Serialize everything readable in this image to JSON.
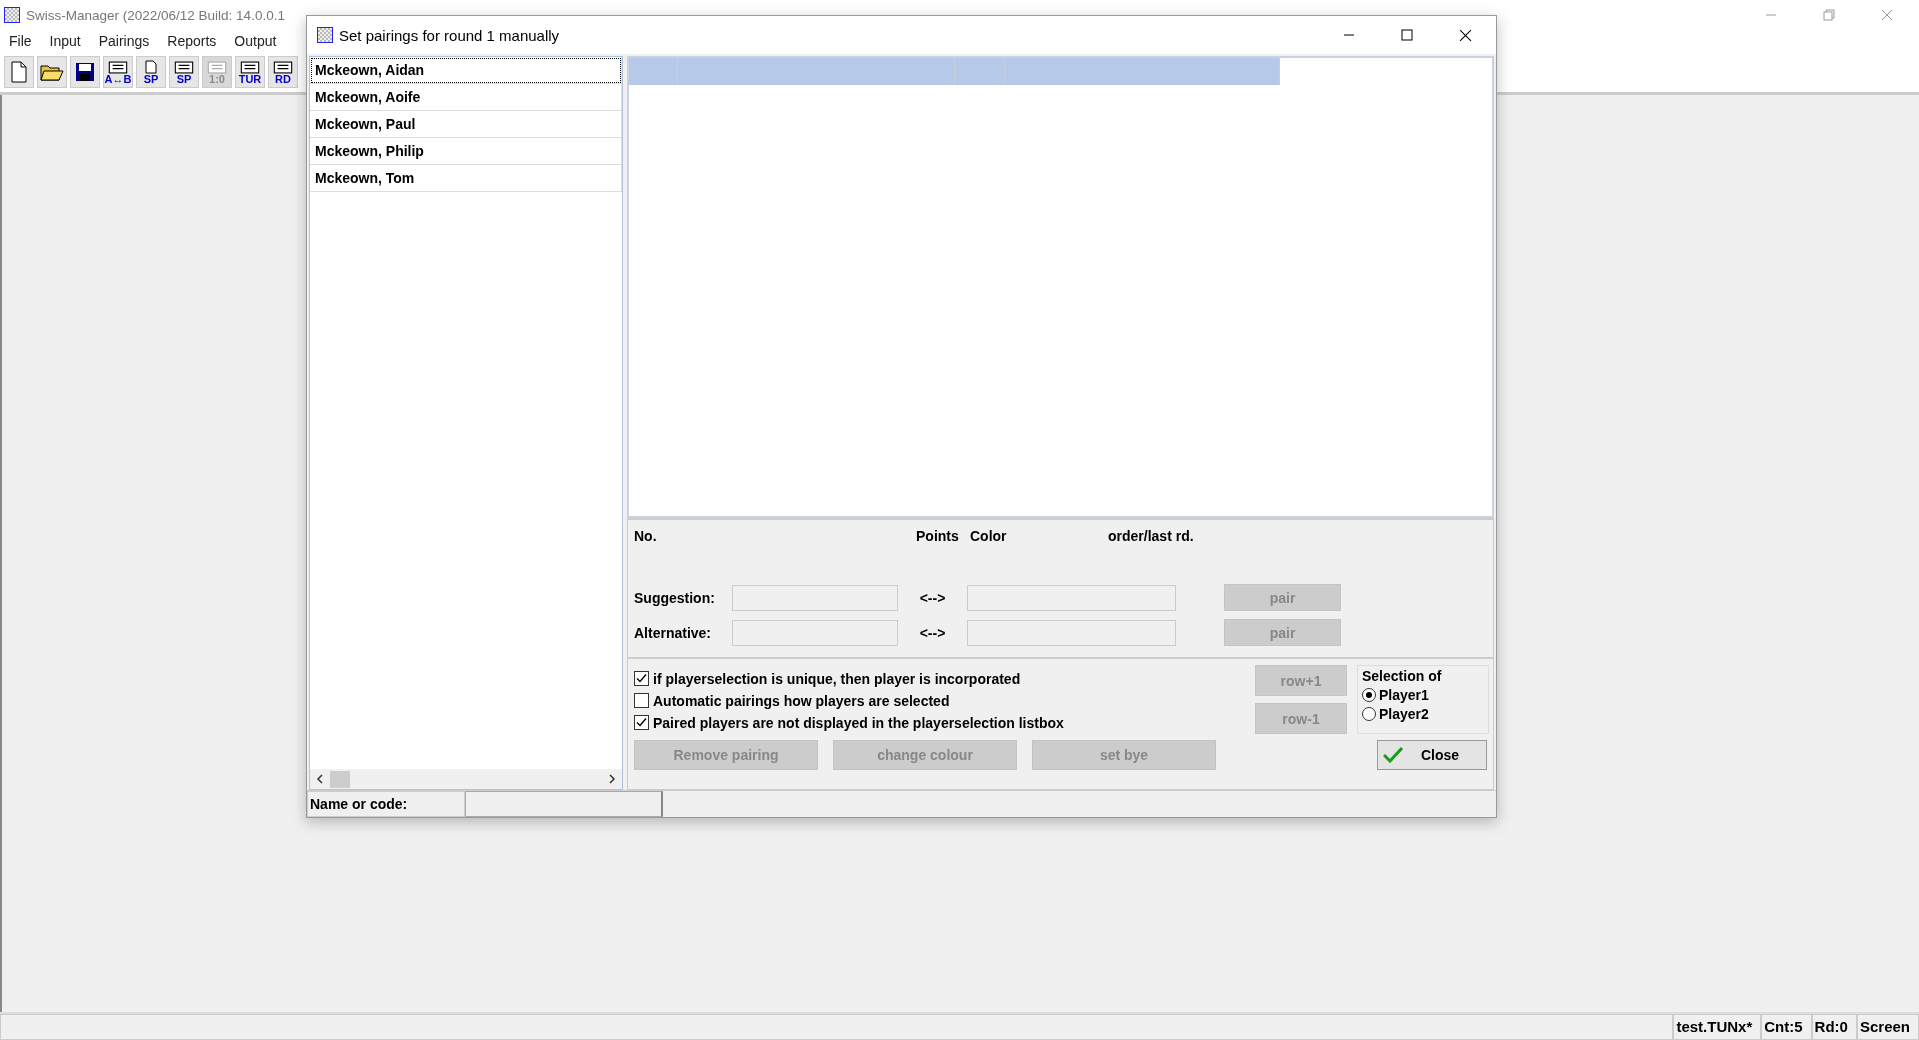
{
  "app": {
    "title": "Swiss-Manager (2022/06/12 Build: 14.0.0.1",
    "menu": [
      "File",
      "Input",
      "Pairings",
      "Reports",
      "Output"
    ],
    "toolbar": [
      {
        "kind": "new"
      },
      {
        "kind": "open"
      },
      {
        "kind": "save"
      },
      {
        "kind": "sheet",
        "label": "A↔B",
        "disabled": false
      },
      {
        "kind": "page",
        "label": "SP",
        "disabled": false
      },
      {
        "kind": "sheet",
        "label": "SP",
        "disabled": false
      },
      {
        "kind": "sheet",
        "label": "1:0",
        "disabled": true
      },
      {
        "kind": "sheet",
        "label": "TUR",
        "disabled": false
      },
      {
        "kind": "sheet",
        "label": "RD",
        "disabled": false
      }
    ]
  },
  "dialog": {
    "title": "Set pairings for round 1 manually",
    "players": [
      {
        "name": "Mckeown, Aidan",
        "selected": true
      },
      {
        "name": "Mckeown, Aoife",
        "selected": false
      },
      {
        "name": "Mckeown, Paul",
        "selected": false
      },
      {
        "name": "Mckeown, Philip",
        "selected": false
      },
      {
        "name": "Mckeown, Tom",
        "selected": false
      }
    ],
    "info_headers": [
      "No.",
      "Points",
      "Color",
      "order/last rd."
    ],
    "pair_rows": [
      {
        "label": "Suggestion:",
        "arrow": "<-->",
        "button": {
          "label": "pair",
          "disabled": true
        }
      },
      {
        "label": "Alternative:",
        "arrow": "<-->",
        "button": {
          "label": "pair",
          "disabled": true
        }
      }
    ],
    "options": [
      {
        "label": "if playerselection is unique, then player is incorporated",
        "checked": true
      },
      {
        "label": "Automatic pairings how players are selected",
        "checked": false
      },
      {
        "label": "Paired players are not displayed in the playerselection listbox",
        "checked": true
      }
    ],
    "row_buttons": [
      {
        "label": "row+1",
        "disabled": true
      },
      {
        "label": "row-1",
        "disabled": true
      }
    ],
    "selection": {
      "title": "Selection of",
      "options": [
        {
          "label": "Player1",
          "selected": true
        },
        {
          "label": "Player2",
          "selected": false
        }
      ]
    },
    "action_buttons": [
      {
        "label": "Remove pairing",
        "disabled": true
      },
      {
        "label": "change colour",
        "disabled": true
      },
      {
        "label": "set bye",
        "disabled": true
      }
    ],
    "close_button": {
      "label": "Close",
      "disabled": false
    },
    "search": {
      "label": "Name or code:"
    }
  },
  "status_bar": [
    "test.TUNx*",
    "Cnt:5",
    "Rd:0",
    "Screen"
  ]
}
